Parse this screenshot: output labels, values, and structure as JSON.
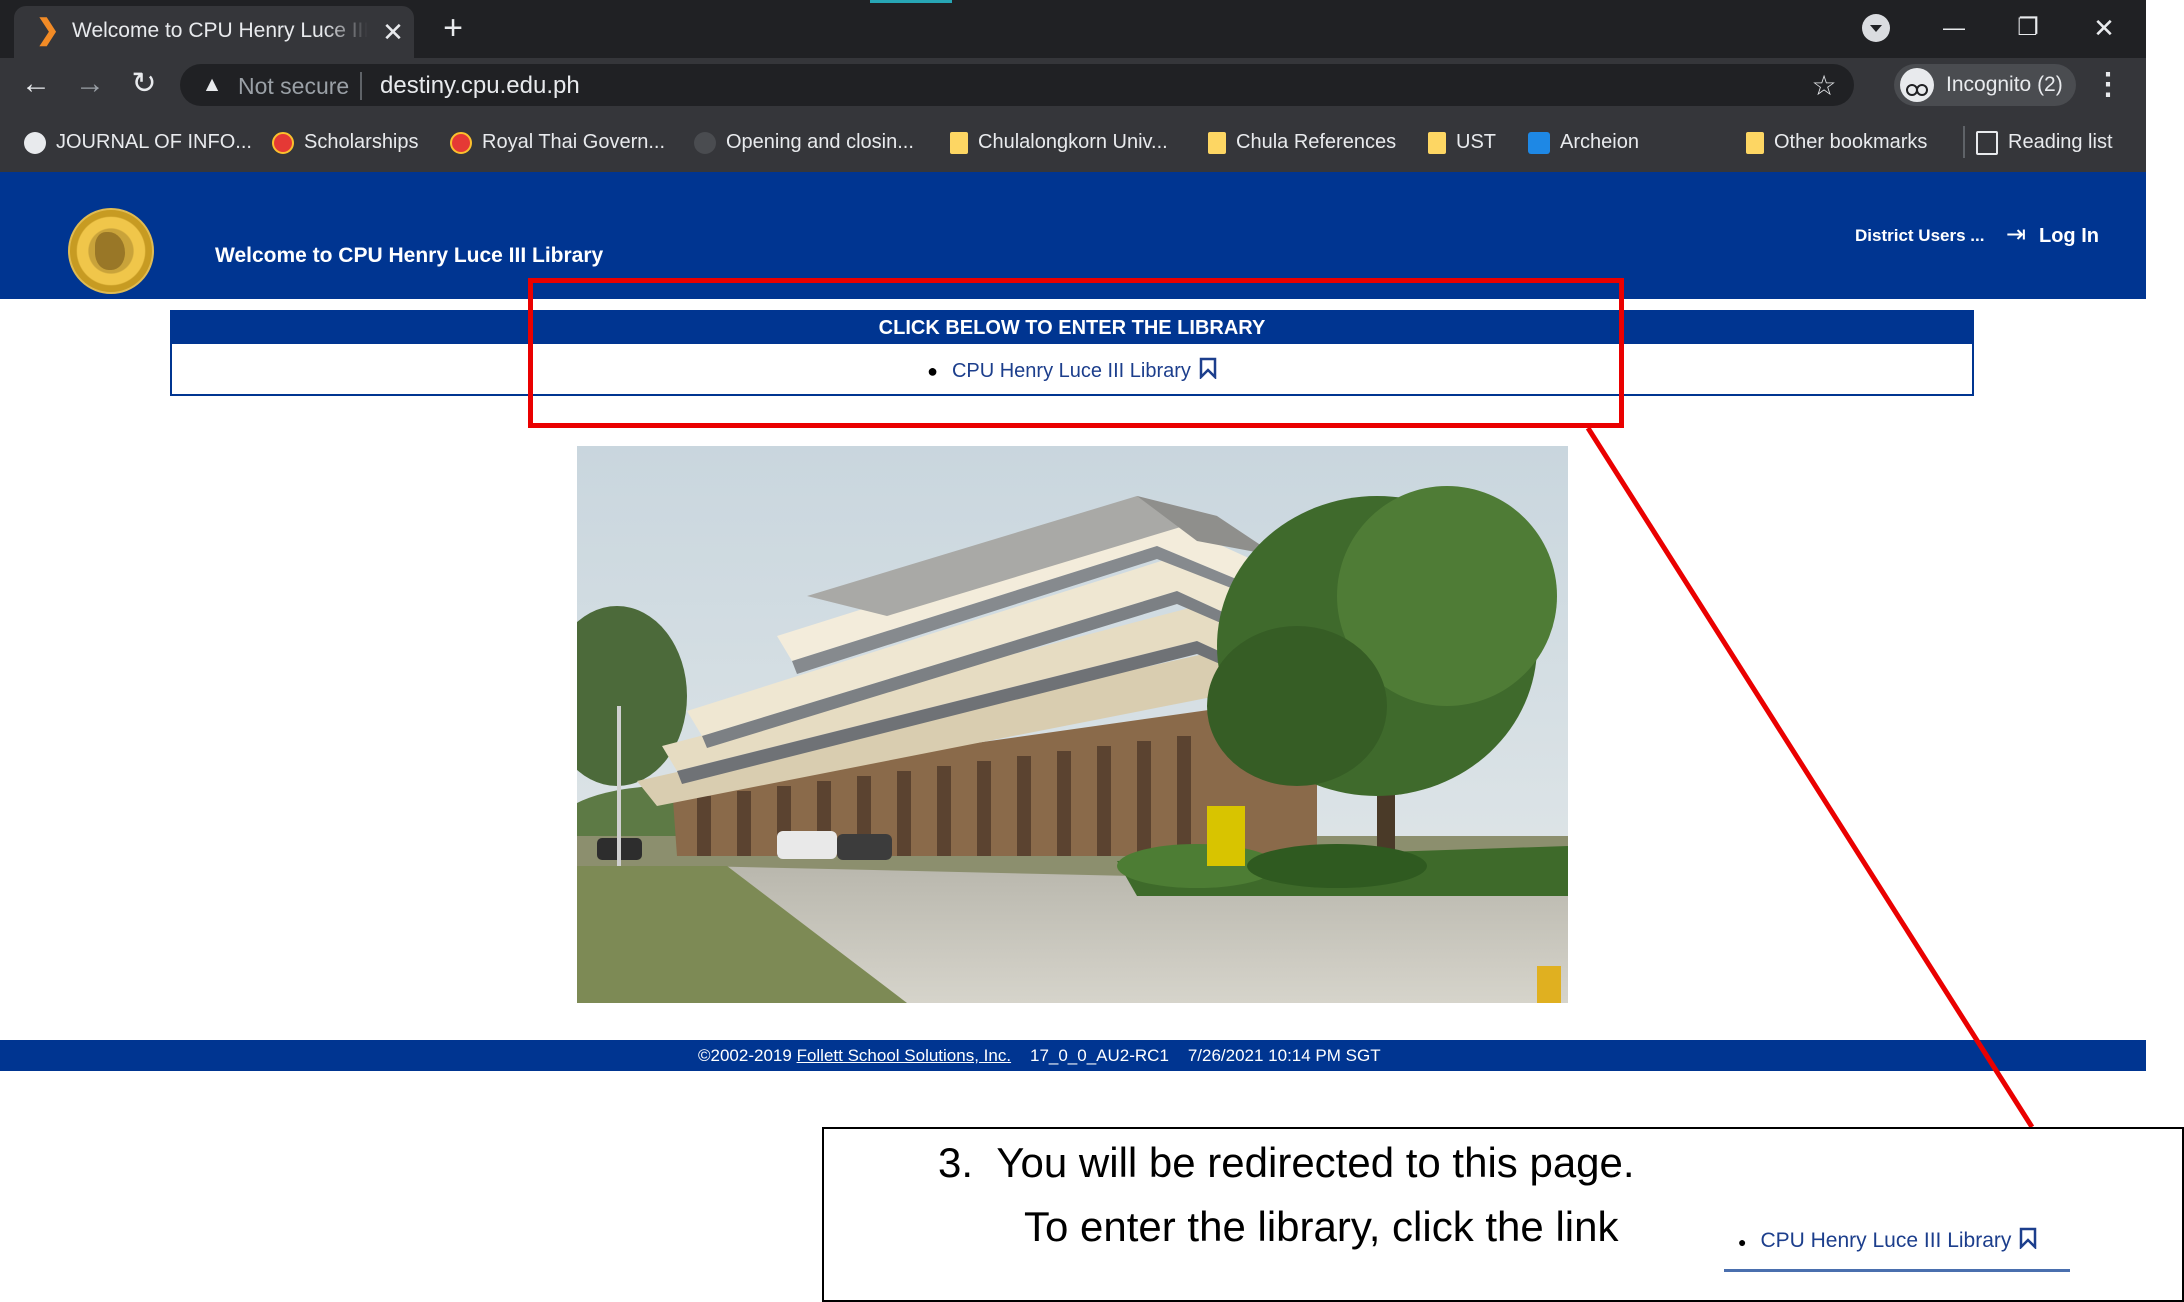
{
  "browser": {
    "tab_title": "Welcome to CPU Henry Luce III Library",
    "tab_close": "✕",
    "new_tab": "+",
    "not_secure_label": "Not secure",
    "url": "destiny.cpu.edu.ph",
    "incognito_label": "Incognito (2)",
    "menu_glyph": "⋮",
    "window_controls": {
      "minimize": "—",
      "restore": "❐",
      "close": "✕"
    },
    "nav": {
      "back": "←",
      "forward": "→",
      "reload": "↻"
    },
    "star": "☆",
    "warn": "▲"
  },
  "bookmarks": [
    {
      "label": "JOURNAL OF INFO...",
      "icon": "globe-icon"
    },
    {
      "label": "Scholarships",
      "icon": "red-seal-icon"
    },
    {
      "label": "Royal Thai Govern...",
      "icon": "red-seal-icon"
    },
    {
      "label": "Opening and closin...",
      "icon": "dark-circle-icon"
    },
    {
      "label": "Chulalongkorn Univ...",
      "icon": "folder-icon"
    },
    {
      "label": "Chula References",
      "icon": "folder-icon"
    },
    {
      "label": "UST",
      "icon": "folder-icon"
    },
    {
      "label": "Archeion",
      "icon": "archeion-icon"
    },
    {
      "label": "Other bookmarks",
      "icon": "folder-icon"
    },
    {
      "label": "Reading list",
      "icon": "reading-list-icon"
    }
  ],
  "page": {
    "site_title": "Welcome to CPU Henry Luce III Library",
    "district_users": "District Users ...",
    "login": "Log In",
    "enter_heading": "CLICK BELOW TO ENTER THE LIBRARY",
    "library_link": "CPU Henry Luce III Library",
    "footer": {
      "copyright": "©2002-2019",
      "company": "Follett School Solutions, Inc.",
      "version": "17_0_0_AU2-RC1",
      "timestamp": "7/26/2021 10:14 PM SGT"
    }
  },
  "annotation": {
    "step_number": "3.",
    "line1": "You will be redirected to this page.",
    "line2": "To enter the library, click the link",
    "sample_link": "CPU Henry Luce III Library"
  },
  "colors": {
    "header_blue": "#003591",
    "annotation_red": "#ea0000",
    "link_blue": "#1c3e8c"
  }
}
